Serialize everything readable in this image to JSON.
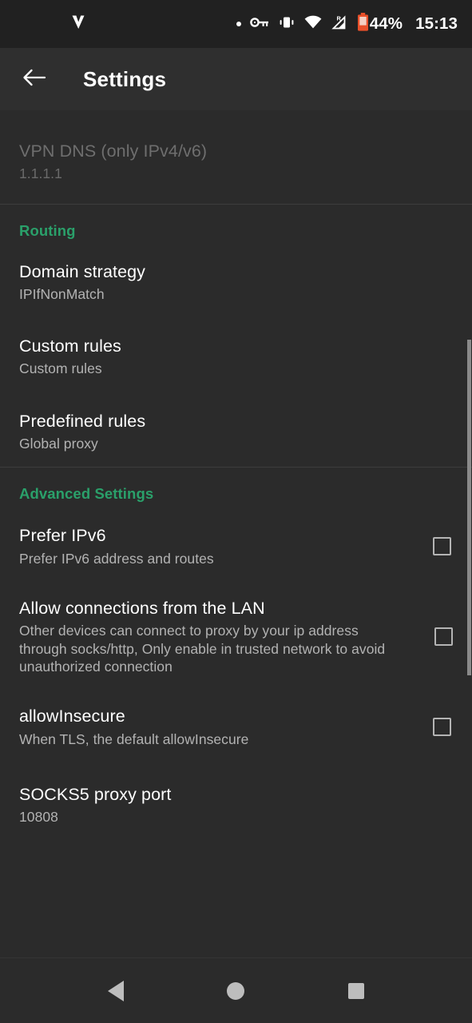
{
  "status_bar": {
    "app_icon": "v2ray-v-icon",
    "icons": [
      "notification-dot-icon",
      "vpn-key-icon",
      "vibrate-icon",
      "wifi-icon",
      "cellular-roaming-icon",
      "battery-low-icon"
    ],
    "roaming_label": "R",
    "battery_percent": "44%",
    "time": "15:13",
    "battery_color": "#e8502a"
  },
  "toolbar": {
    "back_icon": "back-arrow-icon",
    "title": "Settings"
  },
  "accent_color": "#2aa06a",
  "preferences": [
    {
      "key": "vpn_dns",
      "title": "VPN DNS (only IPv4/v6)",
      "summary": "1.1.1.1",
      "disabled": true,
      "has_checkbox": false
    }
  ],
  "sections": [
    {
      "header": "Routing",
      "items": [
        {
          "title": "Domain strategy",
          "summary": "IPIfNonMatch",
          "has_checkbox": false
        },
        {
          "title": "Custom rules",
          "summary": "Custom rules",
          "has_checkbox": false
        },
        {
          "title": "Predefined rules",
          "summary": "Global proxy",
          "has_checkbox": false
        }
      ]
    },
    {
      "header": "Advanced Settings",
      "items": [
        {
          "title": "Prefer IPv6",
          "summary": "Prefer IPv6 address and routes",
          "has_checkbox": true,
          "checked": false
        },
        {
          "title": "Allow connections from the LAN",
          "summary": "Other devices can connect to proxy by your ip address through socks/http, Only enable in trusted network to avoid unauthorized connection",
          "has_checkbox": true,
          "checked": false
        },
        {
          "title": "allowInsecure",
          "summary": "When TLS, the default allowInsecure",
          "has_checkbox": true,
          "checked": false
        },
        {
          "title": "SOCKS5 proxy port",
          "summary": "10808",
          "has_checkbox": false
        }
      ]
    }
  ],
  "scrollbar": {
    "visible": true
  },
  "nav_bar": {
    "back": "nav-back-icon",
    "home": "nav-home-icon",
    "recents": "nav-recents-icon"
  }
}
